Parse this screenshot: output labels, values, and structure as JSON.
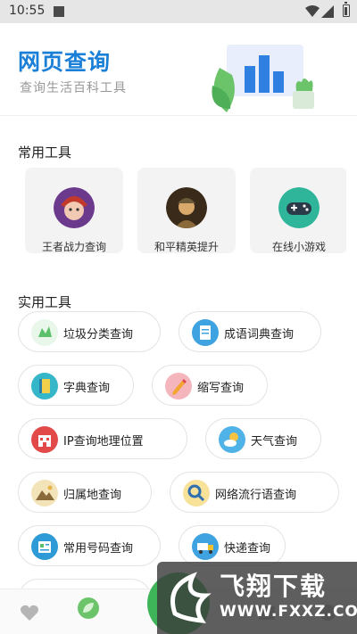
{
  "status_bar": {
    "time": "10:55"
  },
  "header": {
    "title": "网页查询",
    "subtitle": "查询生活百科工具"
  },
  "common_tools": {
    "title": "常用工具",
    "items": [
      {
        "label": "王者战力查询",
        "icon": "hero-avatar-icon"
      },
      {
        "label": "和平精英提升",
        "icon": "soldier-avatar-icon"
      },
      {
        "label": "在线小游戏",
        "icon": "gamepad-icon"
      }
    ]
  },
  "practical_tools": {
    "title": "实用工具",
    "items": [
      {
        "label": "垃圾分类查询",
        "icon": "recycle-icon",
        "color": "#5cc06b"
      },
      {
        "label": "成语词典查询",
        "icon": "book-icon",
        "color": "#3ea3e0"
      },
      {
        "label": "字典查询",
        "icon": "dictionary-icon",
        "color": "#36b6c9"
      },
      {
        "label": "缩写查询",
        "icon": "pencil-icon",
        "color": "#f07d8a"
      },
      {
        "label": "IP查询地理位置",
        "icon": "building-icon",
        "color": "#e24a4a"
      },
      {
        "label": "天气查询",
        "icon": "weather-icon",
        "color": "#4fb3e8"
      },
      {
        "label": "归属地查询",
        "icon": "mountain-icon",
        "color": "#e8b24a"
      },
      {
        "label": "网络流行语查询",
        "icon": "magnifier-icon",
        "color": "#f2c12e"
      },
      {
        "label": "常用号码查询",
        "icon": "phonebook-icon",
        "color": "#2f9bd6"
      },
      {
        "label": "快递查询",
        "icon": "truck-icon",
        "color": "#3ea3e0"
      }
    ]
  },
  "bottom_nav": {
    "items": [
      {
        "icon": "heart-icon"
      },
      {
        "icon": "leaf-home-icon"
      },
      {
        "icon": "center-fab-icon"
      },
      {
        "icon": "box-icon"
      },
      {
        "icon": "profile-icon"
      }
    ]
  },
  "watermark": {
    "brand": "飞翔下载",
    "url": "WWW.FXXZ.COM"
  }
}
